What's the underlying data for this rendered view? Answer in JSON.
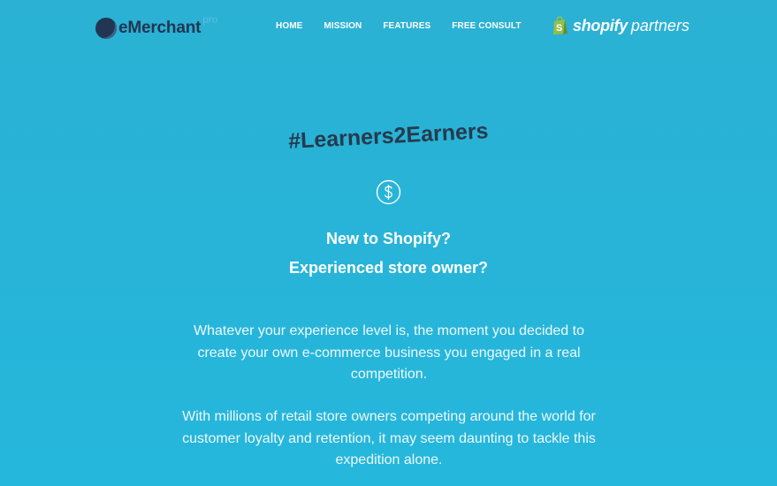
{
  "header": {
    "logo": {
      "text": "eMerchant",
      "sup": "pro"
    },
    "nav": [
      {
        "label": "HOME"
      },
      {
        "label": "MISSION"
      },
      {
        "label": "FEATURES"
      },
      {
        "label": "FREE CONSULT"
      }
    ],
    "partner": {
      "brand": "shopify",
      "suffix": "partners",
      "icon": "shopify-bag-icon"
    }
  },
  "hero": {
    "hashtag": "#Learners2Earners",
    "icon": "dollar-coin-icon",
    "headline_1": "New to Shopify?",
    "headline_2": "Experienced store owner?",
    "paragraph_1": "Whatever your experience level is, the moment you decided to create your own e-commerce business you engaged in a real competition.",
    "paragraph_2": "With millions of retail store owners competing around the world for customer loyalty and retention, it may seem daunting to tackle this expedition alone."
  },
  "colors": {
    "background": "#2ab4d8",
    "logo_dark": "#203653",
    "logo_pro": "#57bfe5",
    "hashtag": "#263a4f",
    "text": "#ffffff",
    "shopify_bag": "#95bf47"
  }
}
